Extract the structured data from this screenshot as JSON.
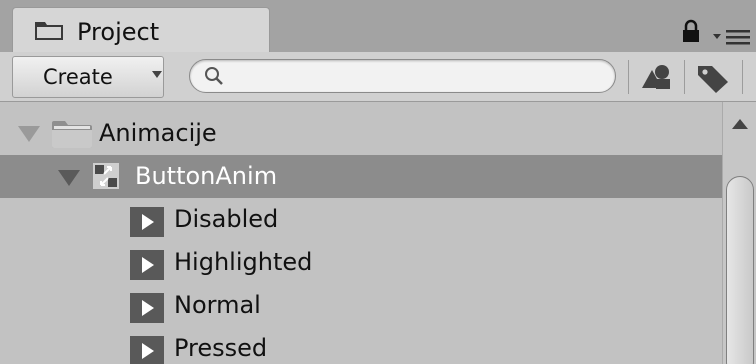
{
  "window": {
    "tab_title": "Project"
  },
  "toolbar": {
    "create_label": "Create",
    "search_placeholder": "",
    "search_value": ""
  },
  "tree": {
    "items": [
      {
        "label": "Animacije",
        "type": "folder",
        "expanded": true
      },
      {
        "label": "ButtonAnim",
        "type": "animator-controller",
        "expanded": true,
        "selected": true
      },
      {
        "label": "Disabled",
        "type": "animation-clip"
      },
      {
        "label": "Highlighted",
        "type": "animation-clip"
      },
      {
        "label": "Normal",
        "type": "animation-clip"
      },
      {
        "label": "Pressed",
        "type": "animation-clip"
      }
    ]
  },
  "icons": {
    "tab": "folder-icon",
    "lock": "lock-icon",
    "menu": "panel-menu-icon",
    "search": "search-icon",
    "filter_type": "filter-by-type-icon",
    "filter_label": "filter-by-label-icon",
    "clip": "play-icon"
  },
  "colors": {
    "selected_row": "#8c8c8c",
    "panel_background": "#c2c2c2",
    "clip_icon": "#595959"
  }
}
